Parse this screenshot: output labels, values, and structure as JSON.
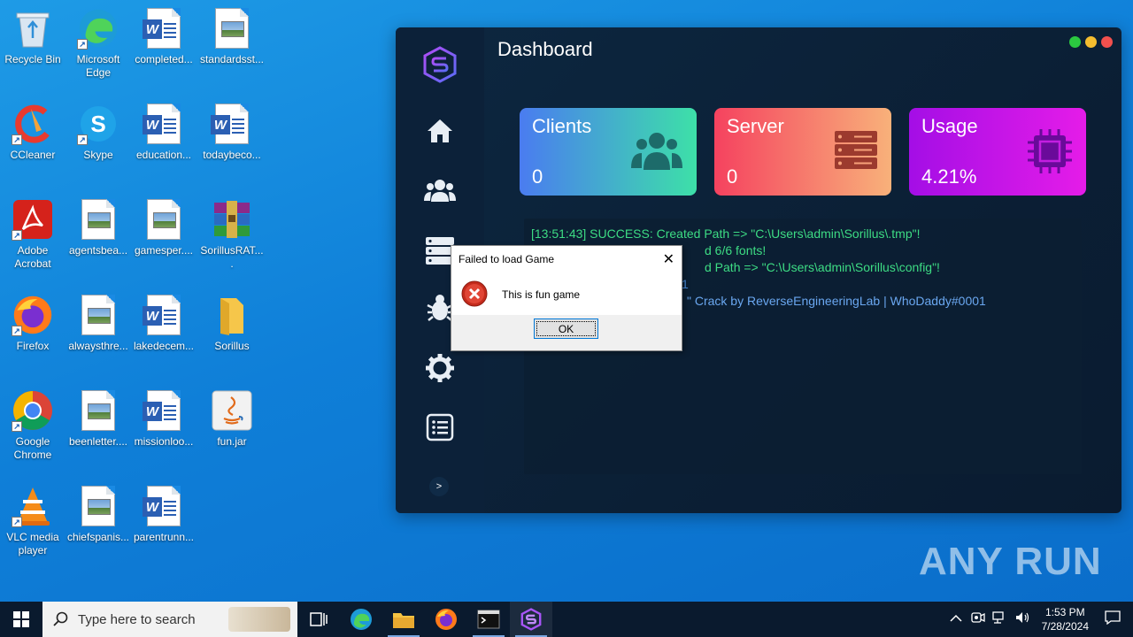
{
  "desktop": {
    "icons": [
      {
        "label": "Recycle Bin",
        "icon": "recycle-bin-icon"
      },
      {
        "label": "Microsoft Edge",
        "icon": "edge-icon"
      },
      {
        "label": "completed...",
        "icon": "word-doc-icon"
      },
      {
        "label": "standardsst...",
        "icon": "image-file-icon"
      },
      {
        "label": "CCleaner",
        "icon": "ccleaner-icon"
      },
      {
        "label": "Skype",
        "icon": "skype-icon"
      },
      {
        "label": "education...",
        "icon": "word-doc-icon"
      },
      {
        "label": "todaybeco...",
        "icon": "word-doc-icon"
      },
      {
        "label": "Adobe Acrobat",
        "icon": "acrobat-icon"
      },
      {
        "label": "agentsbea...",
        "icon": "image-file-icon"
      },
      {
        "label": "gamesper....",
        "icon": "image-file-icon"
      },
      {
        "label": "SorillusRAT....",
        "icon": "winrar-icon"
      },
      {
        "label": "Firefox",
        "icon": "firefox-icon"
      },
      {
        "label": "alwaysthre...",
        "icon": "image-file-icon"
      },
      {
        "label": "lakedecem...",
        "icon": "word-doc-icon"
      },
      {
        "label": "Sorillus",
        "icon": "folder-icon"
      },
      {
        "label": "Google Chrome",
        "icon": "chrome-icon"
      },
      {
        "label": "beenletter....",
        "icon": "image-file-icon"
      },
      {
        "label": "missionloo...",
        "icon": "word-doc-icon"
      },
      {
        "label": "fun.jar",
        "icon": "java-icon"
      },
      {
        "label": "VLC media player",
        "icon": "vlc-icon"
      },
      {
        "label": "chiefspanis...",
        "icon": "image-file-icon"
      },
      {
        "label": "parentrunn...",
        "icon": "word-doc-icon"
      }
    ]
  },
  "app": {
    "title": "Dashboard",
    "cards": [
      {
        "title": "Clients",
        "value": "0"
      },
      {
        "title": "Server",
        "value": "0"
      },
      {
        "title": "Usage",
        "value": "4.21%"
      }
    ],
    "console_lines": [
      {
        "text": "[13:51:43] SUCCESS: Created Path => \"C:\\Users\\admin\\Sorillus\\.tmp\"!",
        "color": "#3ddc84"
      },
      {
        "text": "d 6/6 fonts!",
        "color": "#3ddc84"
      },
      {
        "text": "d Path => \"C:\\Users\\admin\\Sorillus\\config\"!",
        "color": "#3ddc84"
      },
      {
        "text": "1",
        "color": "#4a8fe0"
      },
      {
        "text": "\" Crack by ReverseEngineeringLab | WhoDaddy#0001",
        "color": "#6aa7f0"
      }
    ],
    "expand_label": ">"
  },
  "dialog": {
    "title": "Failed to load Game",
    "message": "This is fun game",
    "ok_label": "OK",
    "close_label": "✕"
  },
  "taskbar": {
    "search_placeholder": "Type here to search",
    "time": "1:53 PM",
    "date": "7/28/2024"
  },
  "watermark": "ANY RUN",
  "colors": {
    "clients_gradient": [
      "#4a7cf0",
      "#3de0a8"
    ],
    "server_gradient": [
      "#f5425f",
      "#f8b17a"
    ],
    "usage_gradient": [
      "#a40ee6",
      "#e51ce8"
    ]
  }
}
